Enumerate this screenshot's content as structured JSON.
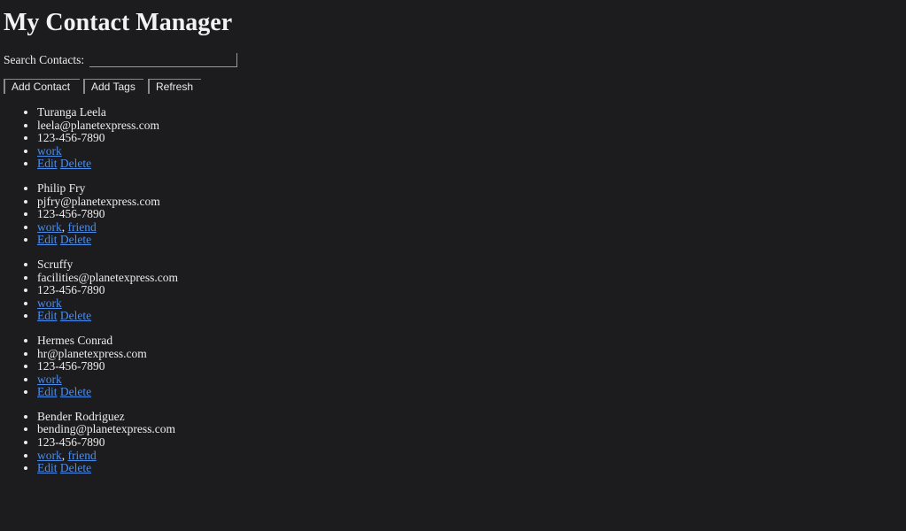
{
  "header": {
    "title": "My Contact Manager"
  },
  "search": {
    "label": "Search Contacts:",
    "value": "",
    "placeholder": ""
  },
  "toolbar": {
    "add_contact_label": "Add Contact",
    "add_tags_label": "Add Tags",
    "refresh_label": "Refresh"
  },
  "contacts": [
    {
      "name": "Turanga Leela",
      "email": "leela@planetexpress.com",
      "phone": "123-456-7890",
      "tags": [
        "work"
      ],
      "edit_label": "Edit",
      "delete_label": "Delete"
    },
    {
      "name": "Philip Fry",
      "email": "pjfry@planetexpress.com",
      "phone": "123-456-7890",
      "tags": [
        "work",
        "friend"
      ],
      "edit_label": "Edit",
      "delete_label": "Delete"
    },
    {
      "name": "Scruffy",
      "email": "facilities@planetexpress.com",
      "phone": "123-456-7890",
      "tags": [
        "work"
      ],
      "edit_label": "Edit",
      "delete_label": "Delete"
    },
    {
      "name": "Hermes Conrad",
      "email": "hr@planetexpress.com",
      "phone": "123-456-7890",
      "tags": [
        "work"
      ],
      "edit_label": "Edit",
      "delete_label": "Delete"
    },
    {
      "name": "Bender Rodriguez",
      "email": "bending@planetexpress.com",
      "phone": "123-456-7890",
      "tags": [
        "work",
        "friend"
      ],
      "edit_label": "Edit",
      "delete_label": "Delete"
    }
  ],
  "colors": {
    "background": "#1c1c1e",
    "text": "#ececec",
    "link": "#4d8dea"
  }
}
